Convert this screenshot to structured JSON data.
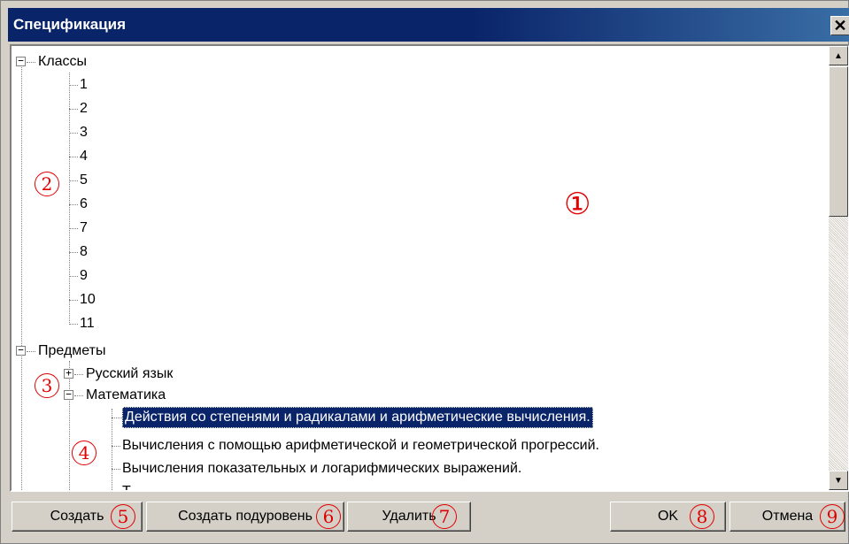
{
  "window": {
    "title": "Спецификация",
    "close_glyph": "✕"
  },
  "tree": {
    "groups": [
      {
        "label": "Классы",
        "expanded": true,
        "expander_glyph": "−",
        "children": [
          "1",
          "2",
          "3",
          "4",
          "5",
          "6",
          "7",
          "8",
          "9",
          "10",
          "11"
        ]
      },
      {
        "label": "Предметы",
        "expanded": true,
        "expander_glyph": "−",
        "children": [
          {
            "label": "Русский язык",
            "expanded": false,
            "expander_glyph": "+"
          },
          {
            "label": "Математика",
            "expanded": true,
            "expander_glyph": "−",
            "children": [
              "Действия со степенями и радикалами и арифметические вычисления.",
              "Вычисления с помощью арифметической и геометрической прогрессий.",
              "Вычисления показательных и логарифмических выражений.",
              "Т"
            ],
            "selected_index": 0
          }
        ]
      }
    ]
  },
  "scrollbar": {
    "up_glyph": "▲",
    "down_glyph": "▼"
  },
  "buttons": {
    "create": "Создать",
    "create_sublevel": "Создать подуровень",
    "delete": "Удалить",
    "ok": "OK",
    "cancel": "Отмена"
  },
  "markers": [
    "①",
    "2",
    "3",
    "4",
    "5",
    "6",
    "7",
    "8",
    "9"
  ],
  "colors": {
    "titlebar": "#0a246a",
    "marker": "#e10000",
    "selection": "#0a246a"
  }
}
